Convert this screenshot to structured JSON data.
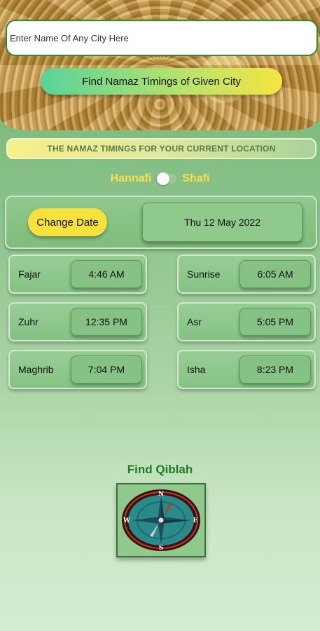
{
  "search": {
    "placeholder": "Enter Name Of Any City Here"
  },
  "find_button": {
    "label": "Find Namaz Timings of Given City"
  },
  "location_banner": {
    "text": "THE NAMAZ TIMINGS FOR YOUR CURRENT LOCATION"
  },
  "madhab": {
    "left_label": "Hannafi",
    "right_label": "Shafi",
    "toggle_on": false
  },
  "date": {
    "change_label": "Change Date",
    "current": "Thu 12 May 2022"
  },
  "prayers": [
    {
      "name": "Fajar",
      "time": "4:46 AM"
    },
    {
      "name": "Sunrise",
      "time": "6:05 AM"
    },
    {
      "name": "Zuhr",
      "time": "12:35 PM"
    },
    {
      "name": "Asr",
      "time": "5:05 PM"
    },
    {
      "name": "Maghrib",
      "time": "7:04 PM"
    },
    {
      "name": "Isha",
      "time": "8:23 PM"
    }
  ],
  "qibla": {
    "title": "Find Qiblah",
    "compass": {
      "n": "N",
      "s": "S",
      "e": "E",
      "w": "W"
    }
  },
  "colors": {
    "accent_green": "#1f7a28",
    "accent_yellow": "#f7e23b",
    "madhab_text": "#f5e04a"
  }
}
